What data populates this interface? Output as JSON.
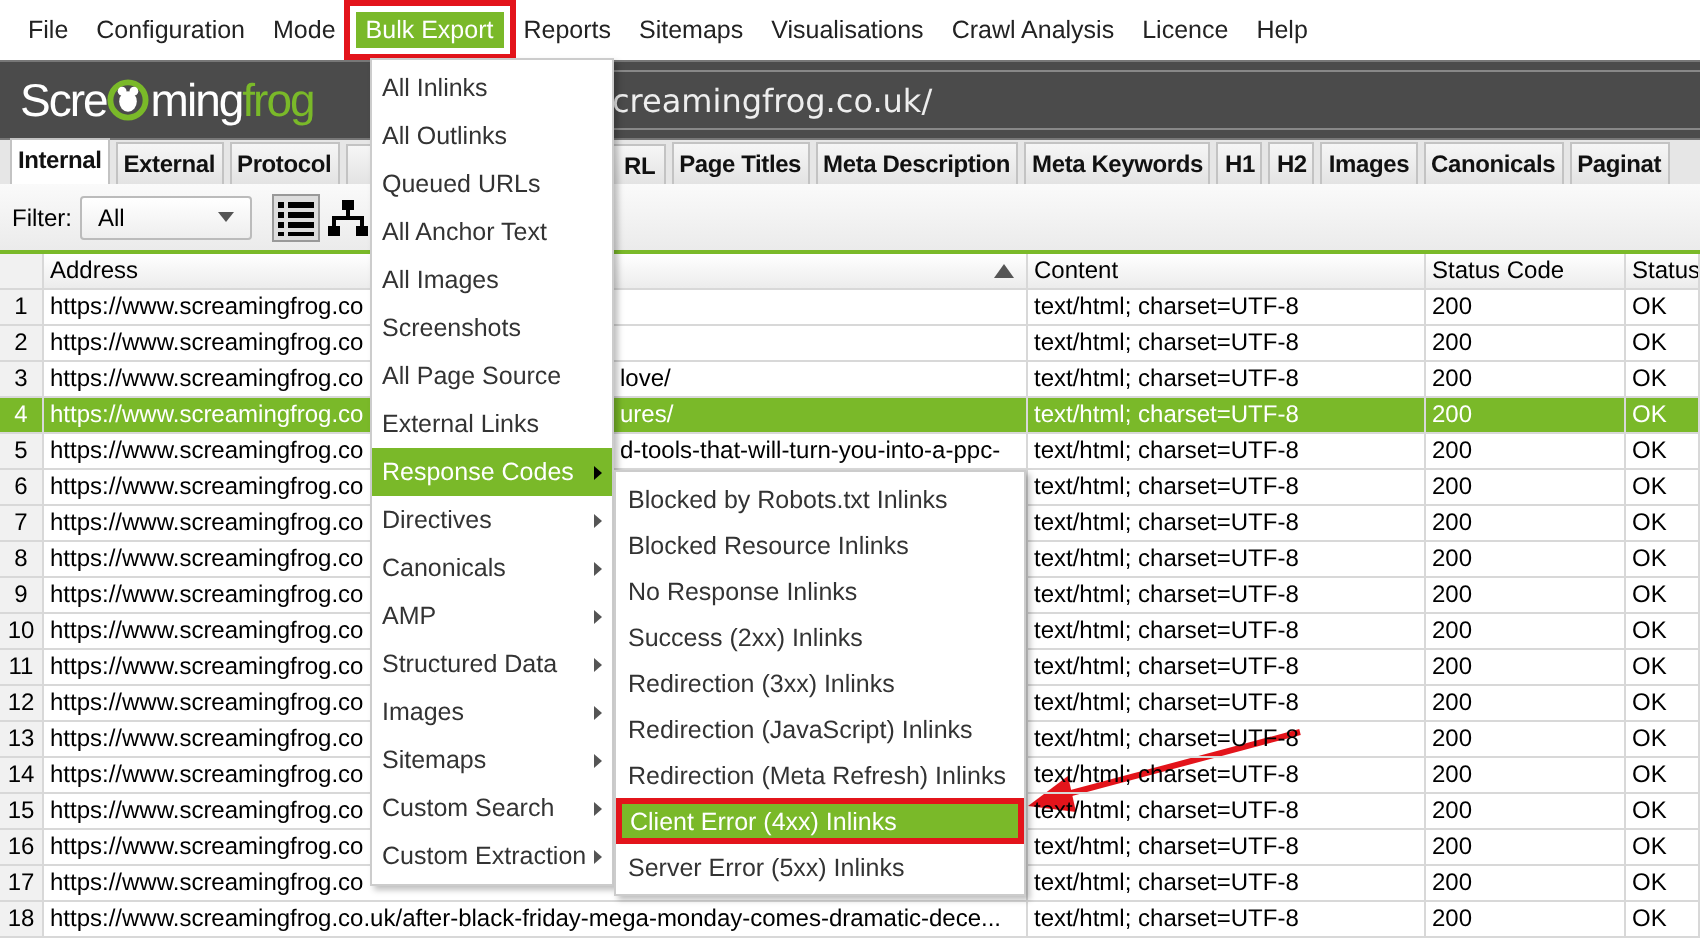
{
  "menubar": [
    {
      "label": "File",
      "open": false,
      "framed": false
    },
    {
      "label": "Configuration",
      "open": false,
      "framed": false
    },
    {
      "label": "Mode",
      "open": false,
      "framed": false
    },
    {
      "label": "Bulk Export",
      "open": true,
      "framed": true
    },
    {
      "label": "Reports",
      "open": false,
      "framed": false
    },
    {
      "label": "Sitemaps",
      "open": false,
      "framed": false
    },
    {
      "label": "Visualisations",
      "open": false,
      "framed": false
    },
    {
      "label": "Crawl Analysis",
      "open": false,
      "framed": false
    },
    {
      "label": "Licence",
      "open": false,
      "framed": false
    },
    {
      "label": "Help",
      "open": false,
      "framed": false
    }
  ],
  "logo": {
    "text_before_icon": "Scre",
    "text_after_icon": "ming",
    "text_green": "frog"
  },
  "url_field": {
    "value": "creamingfrog.co.uk/"
  },
  "tabs": [
    {
      "label": "Internal",
      "selected": true,
      "kind": "full"
    },
    {
      "label": "External",
      "selected": false,
      "kind": "full"
    },
    {
      "label": "Protocol",
      "selected": false,
      "kind": "full"
    },
    {
      "label": "RL",
      "selected": false,
      "kind": "covered"
    },
    {
      "label": "Page Titles",
      "selected": false,
      "kind": "full"
    },
    {
      "label": "Meta Description",
      "selected": false,
      "kind": "full"
    },
    {
      "label": "Meta Keywords",
      "selected": false,
      "kind": "full"
    },
    {
      "label": "H1",
      "selected": false,
      "kind": "full"
    },
    {
      "label": "H2",
      "selected": false,
      "kind": "full"
    },
    {
      "label": "Images",
      "selected": false,
      "kind": "full"
    },
    {
      "label": "Canonicals",
      "selected": false,
      "kind": "full"
    },
    {
      "label": "Paginat",
      "selected": false,
      "kind": "full"
    }
  ],
  "filter": {
    "label": "Filter:",
    "value": "All",
    "views": [
      {
        "kind": "list",
        "selected": true
      },
      {
        "kind": "tree",
        "selected": false
      }
    ]
  },
  "table": {
    "columns": [
      {
        "label": "Address",
        "sorted": true
      },
      {
        "label": "Content",
        "sorted": false
      },
      {
        "label": "Status Code",
        "sorted": false
      },
      {
        "label": "Status"
      }
    ],
    "rows": [
      {
        "num": "1",
        "address": [
          "https://www.screamingfrog.co"
        ],
        "content": "text/html; charset=UTF-8",
        "status_code": "200",
        "status": "OK",
        "selected": false
      },
      {
        "num": "2",
        "address": [
          "https://www.screamingfrog.co"
        ],
        "content": "text/html; charset=UTF-8",
        "status_code": "200",
        "status": "OK",
        "selected": false
      },
      {
        "num": "3",
        "address": [
          "https://www.screamingfrog.co",
          "love/"
        ],
        "content": "text/html; charset=UTF-8",
        "status_code": "200",
        "status": "OK",
        "selected": false
      },
      {
        "num": "4",
        "address": [
          "https://www.screamingfrog.co",
          "ures/"
        ],
        "content": "text/html; charset=UTF-8",
        "status_code": "200",
        "status": "OK",
        "selected": true
      },
      {
        "num": "5",
        "address": [
          "https://www.screamingfrog.co",
          "d-tools-that-will-turn-you-into-a-ppc-"
        ],
        "content": "text/html; charset=UTF-8",
        "status_code": "200",
        "status": "OK",
        "selected": false
      },
      {
        "num": "6",
        "address": [
          "https://www.screamingfrog.co"
        ],
        "content": "text/html; charset=UTF-8",
        "status_code": "200",
        "status": "OK",
        "selected": false
      },
      {
        "num": "7",
        "address": [
          "https://www.screamingfrog.co"
        ],
        "content": "text/html; charset=UTF-8",
        "status_code": "200",
        "status": "OK",
        "selected": false
      },
      {
        "num": "8",
        "address": [
          "https://www.screamingfrog.co"
        ],
        "content": "text/html; charset=UTF-8",
        "status_code": "200",
        "status": "OK",
        "selected": false
      },
      {
        "num": "9",
        "address": [
          "https://www.screamingfrog.co"
        ],
        "content": "text/html; charset=UTF-8",
        "status_code": "200",
        "status": "OK",
        "selected": false
      },
      {
        "num": "10",
        "address": [
          "https://www.screamingfrog.co"
        ],
        "content": "text/html; charset=UTF-8",
        "status_code": "200",
        "status": "OK",
        "selected": false
      },
      {
        "num": "11",
        "address": [
          "https://www.screamingfrog.co"
        ],
        "content": "text/html; charset=UTF-8",
        "status_code": "200",
        "status": "OK",
        "selected": false
      },
      {
        "num": "12",
        "address": [
          "https://www.screamingfrog.co"
        ],
        "content": "text/html; charset=UTF-8",
        "status_code": "200",
        "status": "OK",
        "selected": false
      },
      {
        "num": "13",
        "address": [
          "https://www.screamingfrog.co"
        ],
        "content": "text/html; charset=UTF-8",
        "status_code": "200",
        "status": "OK",
        "selected": false
      },
      {
        "num": "14",
        "address": [
          "https://www.screamingfrog.co"
        ],
        "content": "text/html; charset=UTF-8",
        "status_code": "200",
        "status": "OK",
        "selected": false
      },
      {
        "num": "15",
        "address": [
          "https://www.screamingfrog.co"
        ],
        "content": "text/html; charset=UTF-8",
        "status_code": "200",
        "status": "OK",
        "selected": false
      },
      {
        "num": "16",
        "address": [
          "https://www.screamingfrog.co"
        ],
        "content": "text/html; charset=UTF-8",
        "status_code": "200",
        "status": "OK",
        "selected": false
      },
      {
        "num": "17",
        "address": [
          "https://www.screamingfrog.co"
        ],
        "content": "text/html; charset=UTF-8",
        "status_code": "200",
        "status": "OK",
        "selected": false
      },
      {
        "num": "18",
        "address": [
          "https://www.screamingfrog.co.uk/after-black-friday-mega-monday-comes-dramatic-dece..."
        ],
        "content": "text/html; charset=UTF-8",
        "status_code": "200",
        "status": "OK",
        "selected": false
      }
    ]
  },
  "bulk_export_menu": {
    "items": [
      {
        "label": "All Inlinks",
        "has_submenu": false,
        "selected": false
      },
      {
        "label": "All Outlinks",
        "has_submenu": false,
        "selected": false
      },
      {
        "label": "Queued URLs",
        "has_submenu": false,
        "selected": false
      },
      {
        "label": "All Anchor Text",
        "has_submenu": false,
        "selected": false
      },
      {
        "label": "All Images",
        "has_submenu": false,
        "selected": false
      },
      {
        "label": "Screenshots",
        "has_submenu": false,
        "selected": false
      },
      {
        "label": "All Page Source",
        "has_submenu": false,
        "selected": false
      },
      {
        "label": "External Links",
        "has_submenu": false,
        "selected": false
      },
      {
        "label": "Response Codes",
        "has_submenu": true,
        "selected": true
      },
      {
        "label": "Directives",
        "has_submenu": true,
        "selected": false
      },
      {
        "label": "Canonicals",
        "has_submenu": true,
        "selected": false
      },
      {
        "label": "AMP",
        "has_submenu": true,
        "selected": false
      },
      {
        "label": "Structured Data",
        "has_submenu": true,
        "selected": false
      },
      {
        "label": "Images",
        "has_submenu": true,
        "selected": false
      },
      {
        "label": "Sitemaps",
        "has_submenu": true,
        "selected": false
      },
      {
        "label": "Custom Search",
        "has_submenu": true,
        "selected": false
      },
      {
        "label": "Custom Extraction",
        "has_submenu": true,
        "selected": false
      }
    ]
  },
  "response_codes_submenu": {
    "items": [
      {
        "label": "Blocked by Robots.txt Inlinks",
        "selected": false,
        "framed": false
      },
      {
        "label": "Blocked Resource Inlinks",
        "selected": false,
        "framed": false
      },
      {
        "label": "No Response Inlinks",
        "selected": false,
        "framed": false
      },
      {
        "label": "Success (2xx) Inlinks",
        "selected": false,
        "framed": false
      },
      {
        "label": "Redirection (3xx) Inlinks",
        "selected": false,
        "framed": false
      },
      {
        "label": "Redirection (JavaScript) Inlinks",
        "selected": false,
        "framed": false
      },
      {
        "label": "Redirection (Meta Refresh) Inlinks",
        "selected": false,
        "framed": false
      },
      {
        "label": "Client Error (4xx) Inlinks",
        "selected": true,
        "framed": true
      },
      {
        "label": "Server Error (5xx) Inlinks",
        "selected": false,
        "framed": false
      }
    ]
  },
  "annotation": {
    "arrow": true
  }
}
